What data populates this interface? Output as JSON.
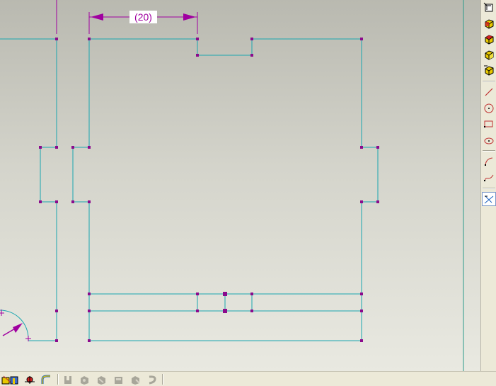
{
  "drawing": {
    "dimension_text": "(20)",
    "line_color": "#1aa6b0",
    "point_color": "#8c0a8c",
    "dimension_color": "#a000a0"
  },
  "right_toolbar": {
    "items": [
      {
        "icon": "coordinate-system-icon"
      },
      {
        "icon": "view-front-cube-icon"
      },
      {
        "icon": "view-top-cube-icon"
      },
      {
        "icon": "view-side-cube-icon"
      },
      {
        "icon": "view-iso-cube-icon"
      },
      {
        "icon": "line-tool-icon"
      },
      {
        "icon": "circle-tool-icon"
      },
      {
        "icon": "rectangle-tool-icon"
      },
      {
        "icon": "ellipse-tool-icon"
      },
      {
        "icon": "arc-tool-icon"
      },
      {
        "icon": "spline-tool-icon"
      },
      {
        "icon": "constraint-tool-icon"
      }
    ]
  },
  "bottom_toolbar": {
    "items": [
      {
        "icon": "sketch-tool-icon"
      },
      {
        "icon": "extrude-tool-icon"
      },
      {
        "icon": "assembly-tool-icon"
      },
      {
        "icon": "sweep-tool-icon"
      },
      {
        "icon": "feature-1-icon"
      },
      {
        "icon": "feature-2-icon"
      },
      {
        "icon": "feature-3-icon"
      },
      {
        "icon": "feature-4-icon"
      },
      {
        "icon": "feature-5-icon"
      },
      {
        "icon": "feature-6-icon"
      }
    ]
  }
}
